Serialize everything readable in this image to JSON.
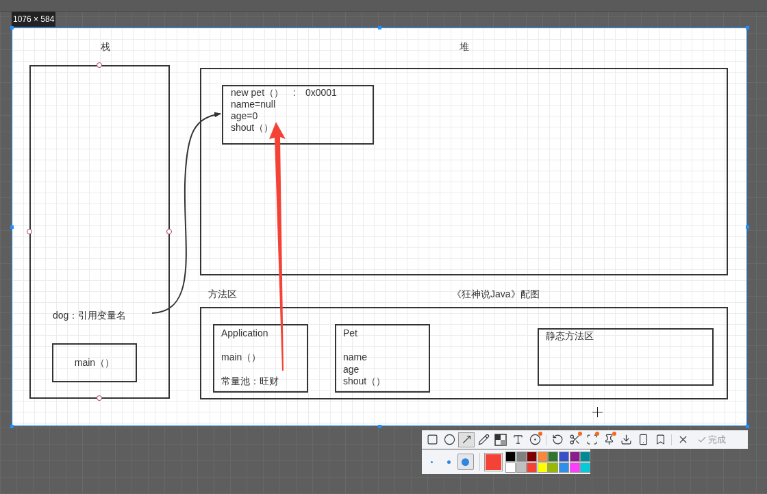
{
  "size_label": "1076 × 584",
  "diagram": {
    "stack_title": "栈",
    "heap_title": "堆",
    "method_area_title": "方法区",
    "caption": "《狂神说Java》配图",
    "stack": {
      "variable": "dog：引用变量名",
      "frame": "main（）"
    },
    "heap_object": [
      "new pet（）　:　0x0001",
      "name=null",
      "age=0",
      "shout（）"
    ],
    "classes": [
      {
        "title": "Application",
        "lines": [
          "main（）",
          "常量池：旺财"
        ]
      },
      {
        "title": "Pet",
        "lines": [
          "name",
          "age",
          "shout（）"
        ]
      }
    ],
    "static_area": "静态方法区"
  },
  "toolbar": {
    "tools": [
      {
        "kind": "rectangle",
        "selected": false,
        "badge": false
      },
      {
        "kind": "ellipse",
        "selected": false,
        "badge": false
      },
      {
        "kind": "arrow",
        "selected": true,
        "badge": false
      },
      {
        "kind": "pen",
        "selected": false,
        "badge": false
      },
      {
        "kind": "mosaic",
        "selected": false,
        "badge": false
      },
      {
        "kind": "text",
        "selected": false,
        "badge": false
      },
      {
        "kind": "number",
        "selected": false,
        "badge": true
      },
      {
        "kind": "undo",
        "selected": false,
        "badge": false
      },
      {
        "kind": "cut",
        "selected": false,
        "badge": true
      },
      {
        "kind": "fit",
        "selected": false,
        "badge": true
      },
      {
        "kind": "pin",
        "selected": false,
        "badge": true
      },
      {
        "kind": "download",
        "selected": false,
        "badge": false
      },
      {
        "kind": "phone",
        "selected": false,
        "badge": false
      },
      {
        "kind": "bookmark",
        "selected": false,
        "badge": false
      },
      {
        "kind": "close",
        "selected": false,
        "badge": false
      }
    ],
    "done": "完成"
  },
  "brush_sizes": [
    {
      "selected": false
    },
    {
      "selected": false
    },
    {
      "selected": true
    }
  ],
  "current_swatch": {
    "color": "#f44336"
  },
  "palette": [
    {
      "color": "#000000"
    },
    {
      "color": "#808080"
    },
    {
      "color": "#800000"
    },
    {
      "color": "#f7883a"
    },
    {
      "color": "#307430"
    },
    {
      "color": "#3852c5"
    },
    {
      "color": "#8c1b8c"
    },
    {
      "color": "#008b94"
    },
    {
      "color": "#ffffff"
    },
    {
      "color": "#c0c0c0"
    },
    {
      "color": "#f44336"
    },
    {
      "color": "#ffff00"
    },
    {
      "color": "#99b800"
    },
    {
      "color": "#3090e8"
    },
    {
      "color": "#ff3cff"
    },
    {
      "color": "#00ccdc"
    }
  ]
}
